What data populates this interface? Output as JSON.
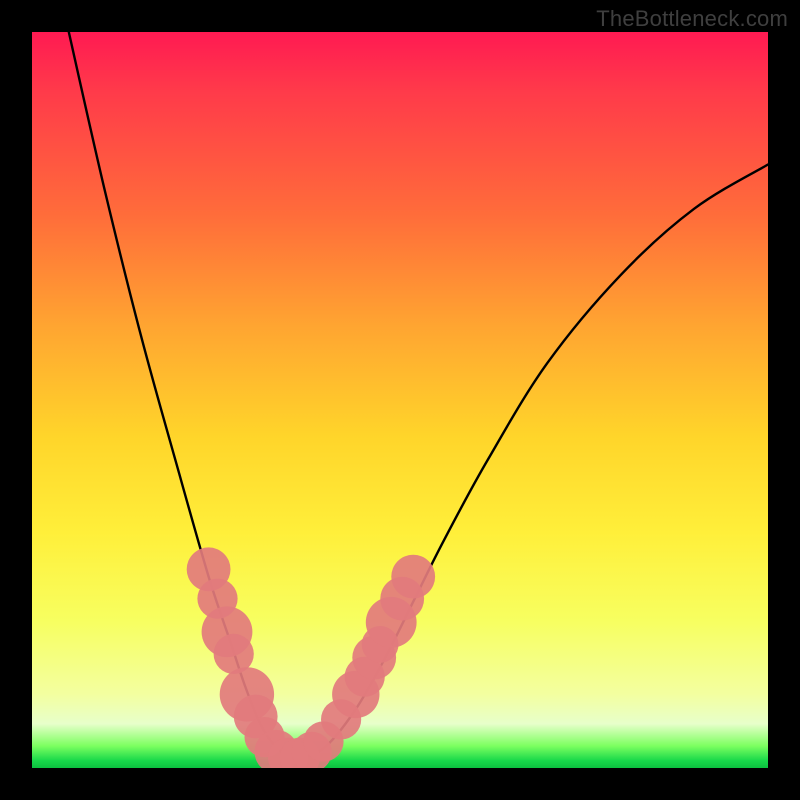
{
  "watermark": "TheBottleneck.com",
  "chart_data": {
    "type": "line",
    "title": "",
    "xlabel": "",
    "ylabel": "",
    "xlim": [
      0,
      100
    ],
    "ylim": [
      0,
      100
    ],
    "grid": false,
    "legend": false,
    "series": [
      {
        "name": "bottleneck-curve",
        "x": [
          5,
          10,
          15,
          20,
          24,
          27,
          29,
          31,
          33,
          35,
          37,
          40,
          44,
          48,
          52,
          56,
          62,
          70,
          80,
          90,
          100
        ],
        "y": [
          100,
          78,
          58,
          40,
          26,
          17,
          11,
          6,
          3,
          1.5,
          1.5,
          3,
          8,
          15,
          23,
          31,
          42,
          55,
          67,
          76,
          82
        ]
      }
    ],
    "markers": {
      "name": "highlighted-points",
      "color": "#e27b7d",
      "points": [
        {
          "x": 24.0,
          "y": 27.0,
          "r": 1.8
        },
        {
          "x": 25.2,
          "y": 23.0,
          "r": 1.6
        },
        {
          "x": 26.5,
          "y": 18.5,
          "r": 2.2
        },
        {
          "x": 27.4,
          "y": 15.5,
          "r": 1.6
        },
        {
          "x": 29.2,
          "y": 10.0,
          "r": 2.4
        },
        {
          "x": 30.4,
          "y": 7.0,
          "r": 1.8
        },
        {
          "x": 31.6,
          "y": 4.2,
          "r": 1.6
        },
        {
          "x": 33.2,
          "y": 2.2,
          "r": 1.8
        },
        {
          "x": 34.8,
          "y": 1.4,
          "r": 1.6
        },
        {
          "x": 36.4,
          "y": 1.4,
          "r": 1.6
        },
        {
          "x": 38.0,
          "y": 2.2,
          "r": 1.6
        },
        {
          "x": 39.6,
          "y": 3.6,
          "r": 1.6
        },
        {
          "x": 42.0,
          "y": 6.6,
          "r": 1.6
        },
        {
          "x": 44.0,
          "y": 10.0,
          "r": 2.0
        },
        {
          "x": 45.2,
          "y": 12.4,
          "r": 1.6
        },
        {
          "x": 46.5,
          "y": 15.0,
          "r": 1.8
        },
        {
          "x": 47.3,
          "y": 16.8,
          "r": 1.4
        },
        {
          "x": 48.8,
          "y": 19.8,
          "r": 2.2
        },
        {
          "x": 50.3,
          "y": 23.0,
          "r": 1.8
        },
        {
          "x": 51.8,
          "y": 26.0,
          "r": 1.8
        }
      ]
    },
    "background_gradient": {
      "stops": [
        {
          "pos": 0,
          "color": "#ff1a52"
        },
        {
          "pos": 25,
          "color": "#ff6d3a"
        },
        {
          "pos": 55,
          "color": "#ffd52a"
        },
        {
          "pos": 80,
          "color": "#f7ff60"
        },
        {
          "pos": 97,
          "color": "#7cff60"
        },
        {
          "pos": 100,
          "color": "#0cc040"
        }
      ]
    }
  }
}
